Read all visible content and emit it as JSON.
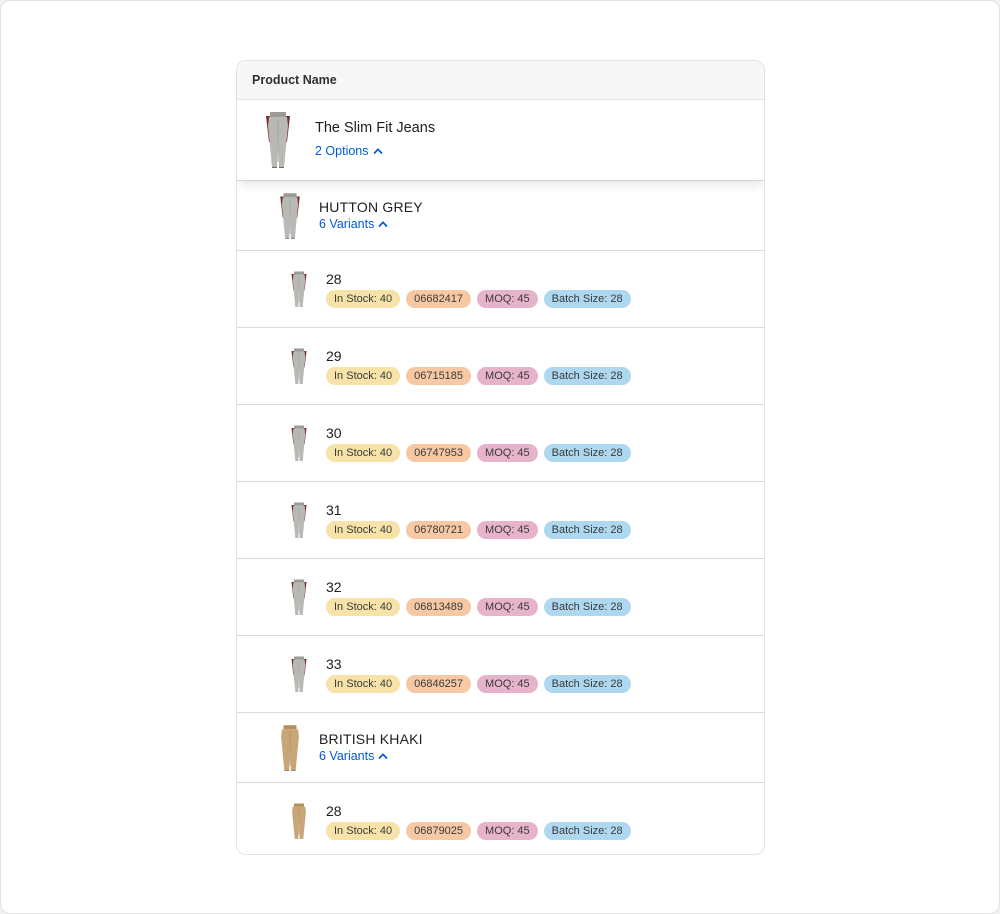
{
  "header": {
    "column_label": "Product Name"
  },
  "product": {
    "title": "The Slim Fit Jeans",
    "options_label": "2 Options",
    "thumb_icon": "grey-jeans-thumbnail"
  },
  "colors": {
    "link": "#005bd3",
    "in_stock_badge": "#f7e3a8",
    "sku_badge": "#f6c9a4",
    "moq_badge": "#e6b3cb",
    "batch_badge": "#aed8ef",
    "grey_jeans": "#b8b8b4",
    "khaki_jeans": "#c8a676"
  },
  "options": [
    {
      "name": "HUTTON GREY",
      "variants_label": "6 Variants",
      "variants": [
        {
          "size": "28",
          "stock": "In Stock: 40",
          "sku": "06682417",
          "moq": "MOQ: 45",
          "batch": "Batch Size: 28"
        },
        {
          "size": "29",
          "stock": "In Stock: 40",
          "sku": "06715185",
          "moq": "MOQ: 45",
          "batch": "Batch Size: 28"
        },
        {
          "size": "30",
          "stock": "In Stock: 40",
          "sku": "06747953",
          "moq": "MOQ: 45",
          "batch": "Batch Size: 28"
        },
        {
          "size": "31",
          "stock": "In Stock: 40",
          "sku": "06780721",
          "moq": "MOQ: 45",
          "batch": "Batch Size: 28"
        },
        {
          "size": "32",
          "stock": "In Stock: 40",
          "sku": "06813489",
          "moq": "MOQ: 45",
          "batch": "Batch Size: 28"
        },
        {
          "size": "33",
          "stock": "In Stock: 40",
          "sku": "06846257",
          "moq": "MOQ: 45",
          "batch": "Batch Size: 28"
        }
      ]
    },
    {
      "name": "BRITISH KHAKI",
      "variants_label": "6 Variants",
      "variants": [
        {
          "size": "28",
          "stock": "In Stock: 40",
          "sku": "06879025",
          "moq": "MOQ: 45",
          "batch": "Batch Size: 28"
        }
      ]
    }
  ]
}
